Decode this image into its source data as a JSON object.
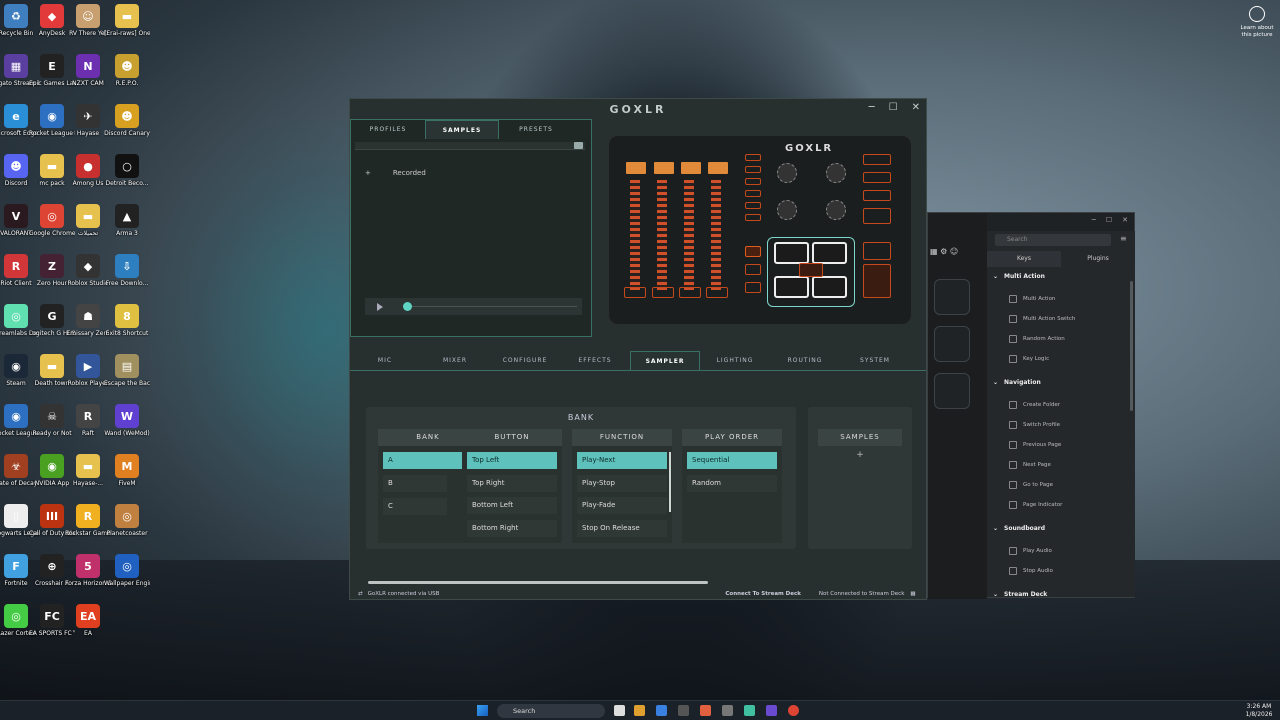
{
  "desktop": {
    "icons": [
      {
        "label": "Recycle Bin",
        "color": "#3f7fc0",
        "glyph": "♻"
      },
      {
        "label": "AnyDesk",
        "color": "#e23a3a",
        "glyph": "◆"
      },
      {
        "label": "RV There Yet",
        "color": "#c8a070",
        "glyph": "☺"
      },
      {
        "label": "[Erai-raws] One Punch ...",
        "color": "#e7c14e",
        "glyph": "▬"
      },
      {
        "label": "Elgato Stream Deck",
        "color": "#5a3fa0",
        "glyph": "▦"
      },
      {
        "label": "Epic Games Launcher",
        "color": "#222222",
        "glyph": "E"
      },
      {
        "label": "NZXT CAM",
        "color": "#6b2fb0",
        "glyph": "N"
      },
      {
        "label": "R.E.P.O.",
        "color": "#c8a030",
        "glyph": "☻"
      },
      {
        "label": "Microsoft Edge",
        "color": "#2b8fd8",
        "glyph": "e"
      },
      {
        "label": "Rocket League®",
        "color": "#2d6fc0",
        "glyph": "◉"
      },
      {
        "label": "Hayase",
        "color": "#333333",
        "glyph": "✈"
      },
      {
        "label": "Discord Canary",
        "color": "#d8a020",
        "glyph": "☻"
      },
      {
        "label": "Discord",
        "color": "#5865f2",
        "glyph": "☻"
      },
      {
        "label": "mc pack",
        "color": "#e7c14e",
        "glyph": "▬"
      },
      {
        "label": "Among Us",
        "color": "#c83030",
        "glyph": "●"
      },
      {
        "label": "Detroit Beco...",
        "color": "#111111",
        "glyph": "○"
      },
      {
        "label": "VALORANT",
        "color": "#2a1a20",
        "glyph": "V"
      },
      {
        "label": "Google Chrome",
        "color": "#dd4433",
        "glyph": "◎"
      },
      {
        "label": "تحميلات",
        "color": "#e7c14e",
        "glyph": "▬"
      },
      {
        "label": "Arma 3",
        "color": "#222222",
        "glyph": "▲"
      },
      {
        "label": "Riot Client",
        "color": "#d13639",
        "glyph": "R"
      },
      {
        "label": "Zero Hour",
        "color": "#442233",
        "glyph": "Z"
      },
      {
        "label": "Roblox Studio",
        "color": "#333333",
        "glyph": "◆"
      },
      {
        "label": "Free Downlo...",
        "color": "#2d7fc0",
        "glyph": "⇩"
      },
      {
        "label": "Streamlabs Desktop",
        "color": "#60e0b0",
        "glyph": "◎"
      },
      {
        "label": "Logitech G HUB",
        "color": "#222222",
        "glyph": "G"
      },
      {
        "label": "Emissary Zero",
        "color": "#444444",
        "glyph": "☗"
      },
      {
        "label": "Exit8 Shortcut",
        "color": "#e0c040",
        "glyph": "8"
      },
      {
        "label": "Steam",
        "color": "#1b2838",
        "glyph": "◉"
      },
      {
        "label": "Death town",
        "color": "#e7c14e",
        "glyph": "▬"
      },
      {
        "label": "Roblox Player",
        "color": "#335599",
        "glyph": "▶"
      },
      {
        "label": "Escape the Backrooms",
        "color": "#a09060",
        "glyph": "▤"
      },
      {
        "label": "Rocket League",
        "color": "#2d6fc0",
        "glyph": "◉"
      },
      {
        "label": "Ready or Not",
        "color": "#333333",
        "glyph": "☠"
      },
      {
        "label": "Raft",
        "color": "#444444",
        "glyph": "R"
      },
      {
        "label": "Wand (WeMod)",
        "color": "#6040d0",
        "glyph": "W"
      },
      {
        "label": "State of Decay 2",
        "color": "#a04020",
        "glyph": "☣"
      },
      {
        "label": "NVIDIA App",
        "color": "#4aa020",
        "glyph": "◉"
      },
      {
        "label": "Hayase-...",
        "color": "#e7c14e",
        "glyph": "▬"
      },
      {
        "label": "FiveM",
        "color": "#e08020",
        "glyph": "M"
      },
      {
        "label": "Hogwarts Legacy",
        "color": "#eeeeee",
        "glyph": "▯"
      },
      {
        "label": "Call of Duty Black Ops III",
        "color": "#bb3311",
        "glyph": "III"
      },
      {
        "label": "Rockstar Games ...",
        "color": "#f0b020",
        "glyph": "R"
      },
      {
        "label": "Planetcoaster",
        "color": "#c08040",
        "glyph": "◎"
      },
      {
        "label": "Fortnite",
        "color": "#40a0e0",
        "glyph": "F"
      },
      {
        "label": "Crosshair X",
        "color": "#222222",
        "glyph": "⊕"
      },
      {
        "label": "Forza Horizon 5",
        "color": "#c0306a",
        "glyph": "5"
      },
      {
        "label": "Wallpaper Engine",
        "color": "#2060c0",
        "glyph": "◎"
      },
      {
        "label": "Razer Cortex",
        "color": "#44cc44",
        "glyph": "◎"
      },
      {
        "label": "EA SPORTS FC™ 26",
        "color": "#222222",
        "glyph": "FC"
      },
      {
        "label": "EA",
        "color": "#e04020",
        "glyph": "EA"
      }
    ],
    "learn_label": "Learn about this picture"
  },
  "goxlr": {
    "logo": "GOXLR",
    "top_tabs": [
      "PROFILES",
      "SAMPLES",
      "PRESETS"
    ],
    "recorded_label": "Recorded",
    "device_logo": "GOXLR",
    "nav_tabs": [
      "MIC",
      "MIXER",
      "CONFIGURE",
      "EFFECTS",
      "SAMPLER",
      "LIGHTING",
      "ROUTING",
      "SYSTEM"
    ],
    "bank_title": "BANK",
    "columns": {
      "bank": {
        "header": "BANK",
        "items": [
          "A",
          "B",
          "C"
        ]
      },
      "button": {
        "header": "BUTTON",
        "items": [
          "Top Left",
          "Top Right",
          "Bottom Left",
          "Bottom Right"
        ]
      },
      "function": {
        "header": "FUNCTION",
        "items": [
          "Play-Next",
          "Play-Stop",
          "Play-Fade",
          "Stop On Release"
        ]
      },
      "play_order": {
        "header": "PLAY ORDER",
        "items": [
          "Sequential",
          "Random"
        ]
      }
    },
    "samples_header": "SAMPLES",
    "status_left": "GoXLR connected via USB",
    "connect_btn": "Connect To Stream Deck",
    "status_right": "Not Connected to Stream Deck"
  },
  "streamdeck": {
    "search_placeholder": "Search",
    "tabs": [
      "Keys",
      "Plugins"
    ],
    "categories": [
      {
        "name": "Multi Action",
        "actions": [
          "Multi Action",
          "Multi Action Switch",
          "Random Action",
          "Key Logic"
        ]
      },
      {
        "name": "Navigation",
        "actions": [
          "Create Folder",
          "Switch Profile",
          "Previous Page",
          "Next Page",
          "Go to Page",
          "Page Indicator"
        ]
      },
      {
        "name": "Soundboard",
        "actions": [
          "Play Audio",
          "Stop Audio"
        ]
      },
      {
        "name": "Stream Deck",
        "actions": []
      }
    ]
  },
  "taskbar": {
    "search_label": "Search",
    "time": "3:26 AM",
    "date": "1/8/2026"
  }
}
